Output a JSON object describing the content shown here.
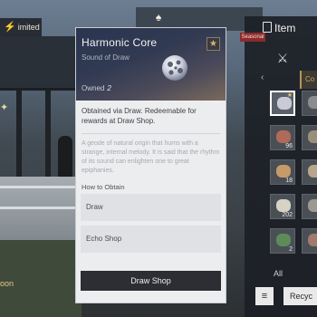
{
  "hud": {
    "limited_label": "imited",
    "bottom_left_label": "oon",
    "colors": {
      "gold": "#f0c24a"
    }
  },
  "tooltip": {
    "title": "Harmonic Core",
    "subtitle": "Sound of Draw",
    "owned_label": "Owned",
    "owned_count": "2",
    "obtained_text": "Obtained via Draw. Redeemable for rewards at Draw Shop.",
    "lore_text": "A geode of natural origin that hums with a strange, internal melody. It is said that the rhythm of its sound can enlighten one to great epiphanies.",
    "how_to_obtain_label": "How to Obtain",
    "sources": [
      "Draw",
      "Echo Shop"
    ],
    "action_button": "Draw Shop",
    "icons": {
      "favorite": "star-icon",
      "item": "orb-icon"
    }
  },
  "item_panel": {
    "title": "Item",
    "badge": "Seasonal",
    "category_tab": "Co",
    "filter_label": "All",
    "recycle_button": "Recyc",
    "slots": [
      {
        "name": "harmonic-core",
        "qty": "",
        "selected": true,
        "color": "#c9ccd6"
      },
      {
        "name": "item-2",
        "qty": "",
        "selected": false,
        "color": "#8a8c90"
      },
      {
        "name": "item-3",
        "qty": "96",
        "selected": false,
        "color": "#b06a5a"
      },
      {
        "name": "item-4",
        "qty": "",
        "selected": false,
        "color": "#9a8f7a"
      },
      {
        "name": "item-5",
        "qty": "18",
        "selected": false,
        "color": "#c79a6a"
      },
      {
        "name": "item-6",
        "qty": "",
        "selected": false,
        "color": "#b7a58c"
      },
      {
        "name": "item-7",
        "qty": "202",
        "selected": false,
        "color": "#d6d2c4"
      },
      {
        "name": "item-8",
        "qty": "",
        "selected": false,
        "color": "#9c9a90"
      },
      {
        "name": "item-9",
        "qty": "2",
        "selected": false,
        "color": "#5f8a5a"
      },
      {
        "name": "item-10",
        "qty": "",
        "selected": false,
        "color": "#a07a6a"
      }
    ]
  }
}
